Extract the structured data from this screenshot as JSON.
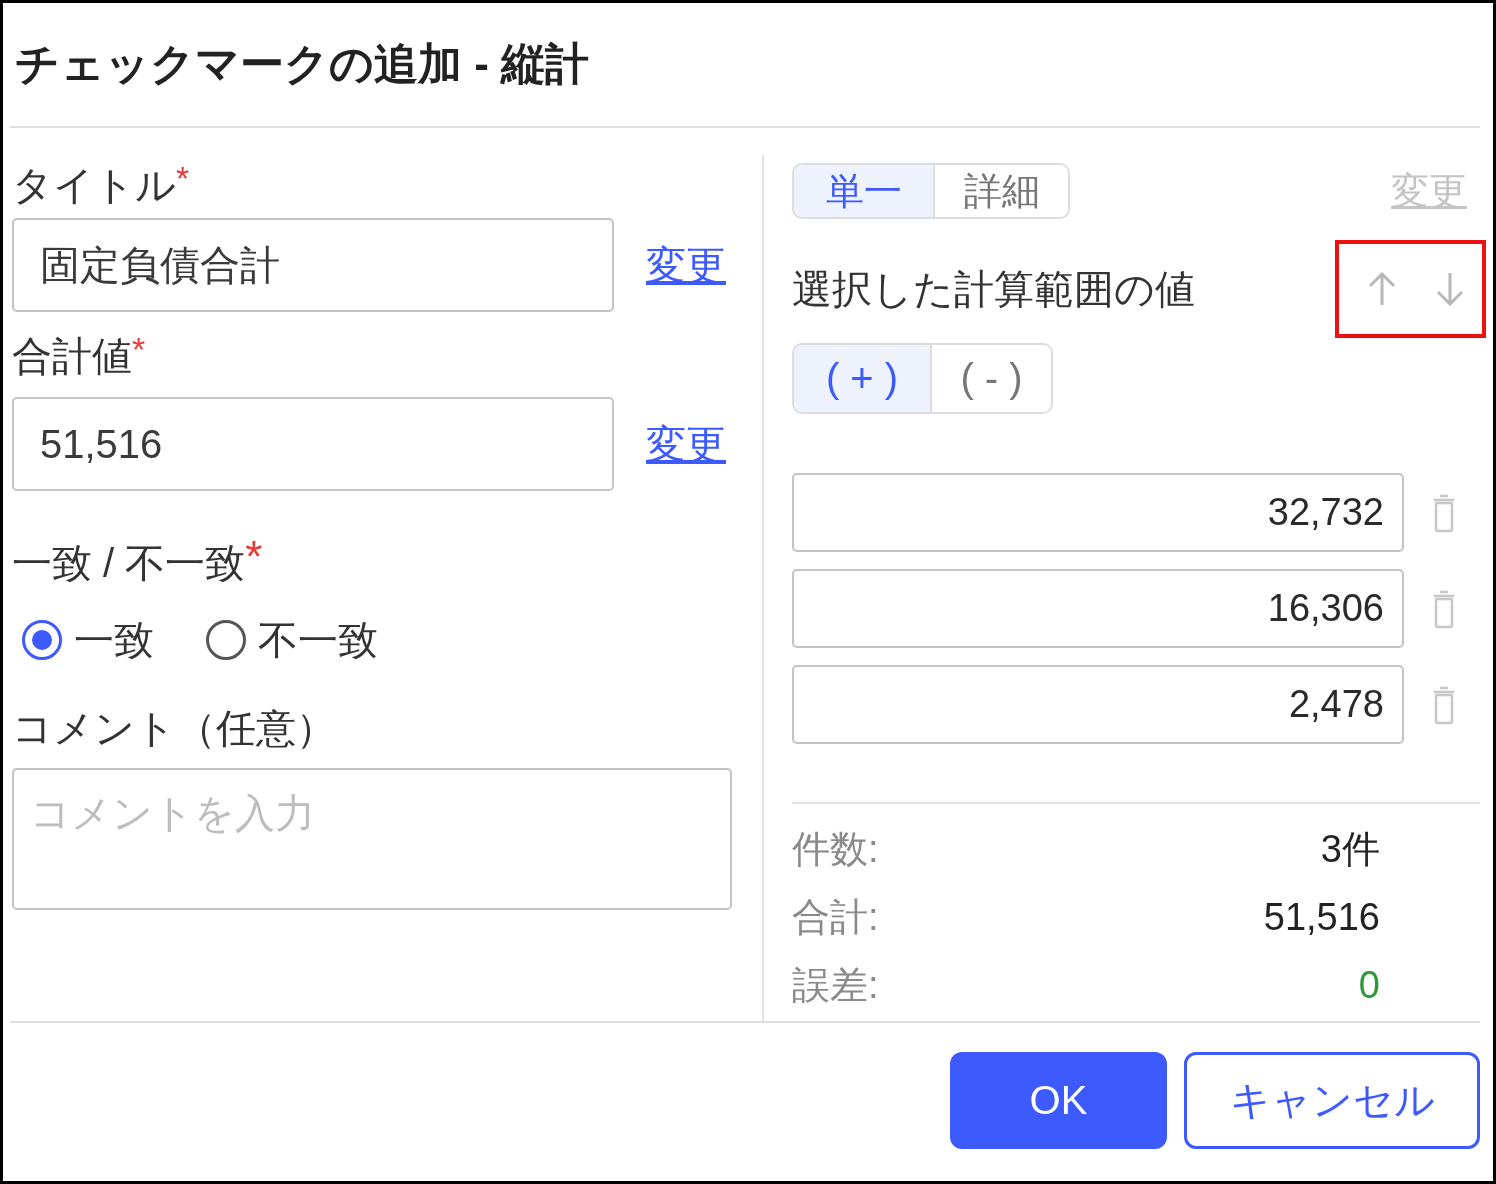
{
  "dialog": {
    "title": "チェックマークの追加 - 縦計"
  },
  "form": {
    "fields": [
      {
        "label": "タイトル",
        "required_mark": "*",
        "value": "固定負債合計",
        "link": {
          "label": "変更",
          "disabled": false
        }
      },
      {
        "label": "合計値",
        "required_mark": "*",
        "value": "51,516",
        "link": {
          "label": "変更",
          "disabled": false
        }
      }
    ],
    "match": {
      "label": "一致 / 不一致",
      "required_mark": "*",
      "options": [
        {
          "label": "一致",
          "selected": true
        },
        {
          "label": "不一致",
          "selected": false
        }
      ]
    },
    "comment": {
      "label": "コメント（任意）",
      "placeholder": "コメントを入力"
    }
  },
  "range_panel": {
    "mode_tabs": [
      {
        "label": "単一",
        "selected": true
      },
      {
        "label": "詳細",
        "selected": false
      }
    ],
    "change_link": {
      "label": "変更",
      "disabled": true
    },
    "heading": "選択した計算範囲の値",
    "reorder": {
      "highlighted": true
    },
    "sign_tabs": [
      {
        "label": "( + )",
        "selected": true
      },
      {
        "label": "( - )",
        "selected": false
      }
    ],
    "values": [
      {
        "value": "32,732"
      },
      {
        "value": "16,306"
      },
      {
        "value": "2,478"
      }
    ],
    "summary": [
      {
        "label": "件数:",
        "value": "3件",
        "color": "#222222"
      },
      {
        "label": "合計:",
        "value": "51,516",
        "color": "#222222"
      },
      {
        "label": "誤差:",
        "value": "0",
        "color": "#2e9a3a"
      }
    ]
  },
  "buttons": [
    {
      "label": "OK",
      "kind": "primary"
    },
    {
      "label": "キャンセル",
      "kind": "secondary"
    }
  ]
}
